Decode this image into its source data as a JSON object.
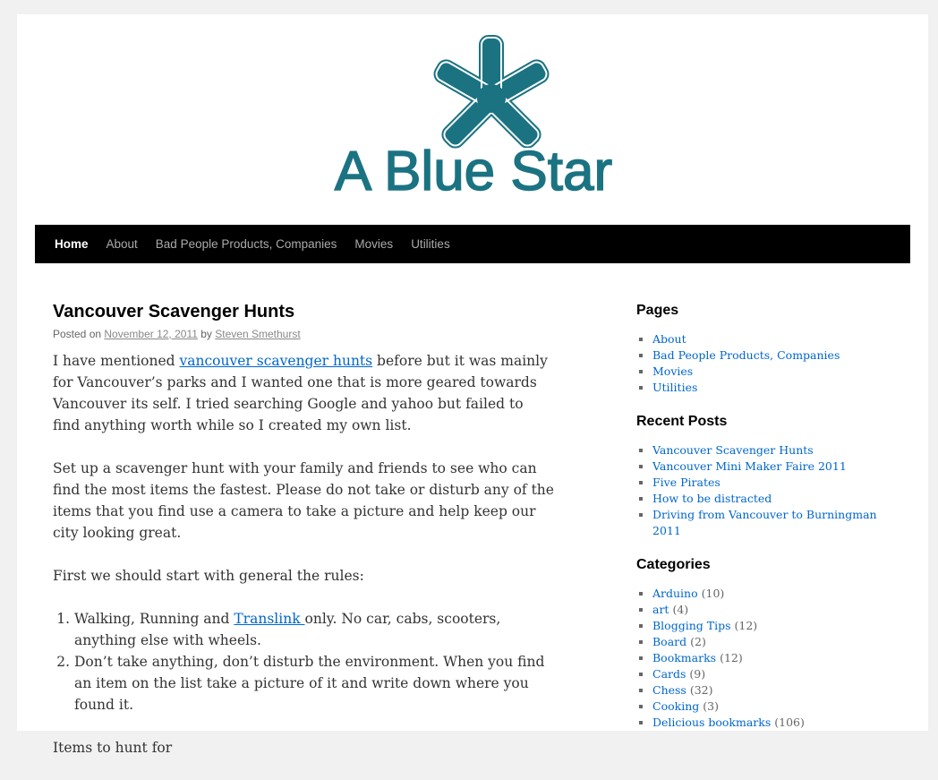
{
  "site": {
    "title": "A Blue Star",
    "logo_color": "#1b7382"
  },
  "nav": {
    "items": [
      {
        "label": "Home",
        "current": true
      },
      {
        "label": "About"
      },
      {
        "label": "Bad People Products, Companies"
      },
      {
        "label": "Movies"
      },
      {
        "label": "Utilities"
      }
    ]
  },
  "post": {
    "title": "Vancouver Scavenger Hunts",
    "meta_posted_on": "Posted on",
    "date": "November 12, 2011",
    "meta_by": "by",
    "author": "Steven Smethurst",
    "p1_before": "I have mentioned ",
    "p1_link": "vancouver scavenger hunts",
    "p1_after": " before but it was mainly for Vancouver’s parks and I wanted one that is more geared towards Vancouver its self. I tried searching Google and yahoo but failed to find anything worth while so I created my own list.",
    "p2": "Set up a scavenger hunt with your family and friends to see who can find the most items the fastest. Please do not take or disturb any of the items that you find use a camera to take a picture and help keep our city looking great.",
    "p3": "First we should start with general the rules:",
    "rule1_before": "Walking, Running and ",
    "rule1_link": "Translink ",
    "rule1_after": "only. No car, cabs, scooters, anything else with wheels.",
    "rule2": "Don’t take anything, don’t disturb the environment. When you find an item on the list take a picture of it and write down where you found it.",
    "p4": "Items to hunt for"
  },
  "sidebar": {
    "pages": {
      "title": "Pages",
      "items": [
        "About",
        "Bad People Products, Companies",
        "Movies",
        "Utilities"
      ]
    },
    "recent": {
      "title": "Recent Posts",
      "items": [
        "Vancouver Scavenger Hunts",
        "Vancouver Mini Maker Faire 2011",
        "Five Pirates",
        "How to be distracted",
        "Driving from Vancouver to Burningman 2011"
      ]
    },
    "categories": {
      "title": "Categories",
      "items": [
        {
          "name": "Arduino",
          "count": "(10)"
        },
        {
          "name": "art",
          "count": "(4)"
        },
        {
          "name": "Blogging Tips",
          "count": "(12)"
        },
        {
          "name": "Board",
          "count": "(2)"
        },
        {
          "name": "Bookmarks",
          "count": "(12)"
        },
        {
          "name": "Cards",
          "count": "(9)"
        },
        {
          "name": "Chess",
          "count": "(32)"
        },
        {
          "name": "Cooking",
          "count": "(3)"
        },
        {
          "name": "Delicious bookmarks",
          "count": "(106)"
        }
      ]
    }
  }
}
